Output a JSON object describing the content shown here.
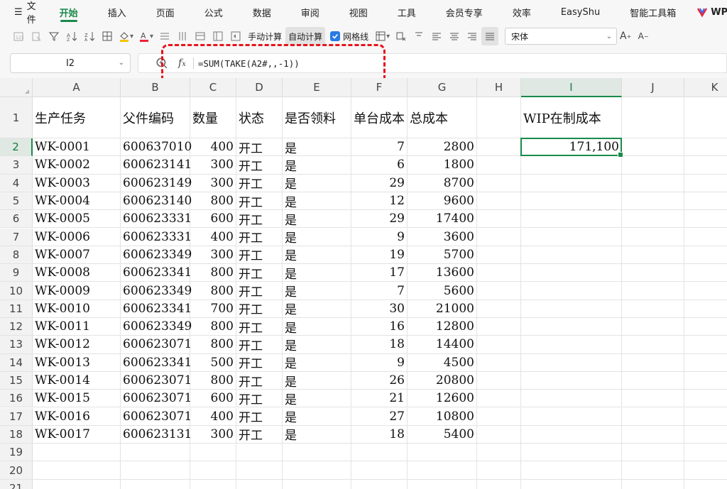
{
  "menu": {
    "file": "文件",
    "tabs": [
      "开始",
      "插入",
      "页面",
      "公式",
      "数据",
      "审阅",
      "视图",
      "工具",
      "会员专享",
      "效率",
      "EasyShu",
      "智能工具箱"
    ],
    "active_tab": "开始",
    "brand": "WPS"
  },
  "toolbar": {
    "manual_calc": "手动计算",
    "auto_calc": "自动计算",
    "gridlines": "网格线",
    "gridlines_checked": true,
    "font_name": "宋体"
  },
  "formula_bar": {
    "name_box": "I2",
    "fx": "fx",
    "formula": "=SUM(TAKE(A2#,,-1))"
  },
  "sheet": {
    "columns": [
      "A",
      "B",
      "C",
      "D",
      "E",
      "F",
      "G",
      "H",
      "I",
      "J",
      "K"
    ],
    "selected_column": "I",
    "selected_row": 2,
    "row_numbers": [
      "1",
      "2",
      "3",
      "4",
      "5",
      "6",
      "7",
      "8",
      "9",
      "10",
      "11",
      "12",
      "13",
      "14",
      "15",
      "16",
      "17",
      "18",
      "19",
      "20",
      "21"
    ],
    "header": [
      "生产任务",
      "父件编码",
      "数量",
      "状态",
      "是否领料",
      "单台成本",
      "总成本"
    ],
    "rows": [
      [
        "WK-0001",
        "600637010",
        "400",
        "开工",
        "是",
        "7",
        "2800"
      ],
      [
        "WK-0002",
        "600623141",
        "300",
        "开工",
        "是",
        "6",
        "1800"
      ],
      [
        "WK-0003",
        "600623149",
        "300",
        "开工",
        "是",
        "29",
        "8700"
      ],
      [
        "WK-0004",
        "600623140",
        "800",
        "开工",
        "是",
        "12",
        "9600"
      ],
      [
        "WK-0005",
        "600623331",
        "600",
        "开工",
        "是",
        "29",
        "17400"
      ],
      [
        "WK-0006",
        "600623331",
        "400",
        "开工",
        "是",
        "9",
        "3600"
      ],
      [
        "WK-0007",
        "600623349",
        "300",
        "开工",
        "是",
        "19",
        "5700"
      ],
      [
        "WK-0008",
        "600623341",
        "800",
        "开工",
        "是",
        "17",
        "13600"
      ],
      [
        "WK-0009",
        "600623349",
        "800",
        "开工",
        "是",
        "7",
        "5600"
      ],
      [
        "WK-0010",
        "600623341",
        "700",
        "开工",
        "是",
        "30",
        "21000"
      ],
      [
        "WK-0011",
        "600623349",
        "800",
        "开工",
        "是",
        "16",
        "12800"
      ],
      [
        "WK-0012",
        "600623071",
        "800",
        "开工",
        "是",
        "18",
        "14400"
      ],
      [
        "WK-0013",
        "600623341",
        "500",
        "开工",
        "是",
        "9",
        "4500"
      ],
      [
        "WK-0014",
        "600623071",
        "800",
        "开工",
        "是",
        "26",
        "20800"
      ],
      [
        "WK-0015",
        "600623071",
        "600",
        "开工",
        "是",
        "21",
        "12600"
      ],
      [
        "WK-0016",
        "600623071",
        "400",
        "开工",
        "是",
        "27",
        "10800"
      ],
      [
        "WK-0017",
        "600623131",
        "300",
        "开工",
        "是",
        "18",
        "5400"
      ]
    ],
    "wip_label": "WIP在制成本",
    "wip_value": "171,100"
  },
  "colors": {
    "accent_green": "#1a8a4a",
    "highlight_red": "#e8131b",
    "checkbox_blue": "#2a7be4"
  }
}
